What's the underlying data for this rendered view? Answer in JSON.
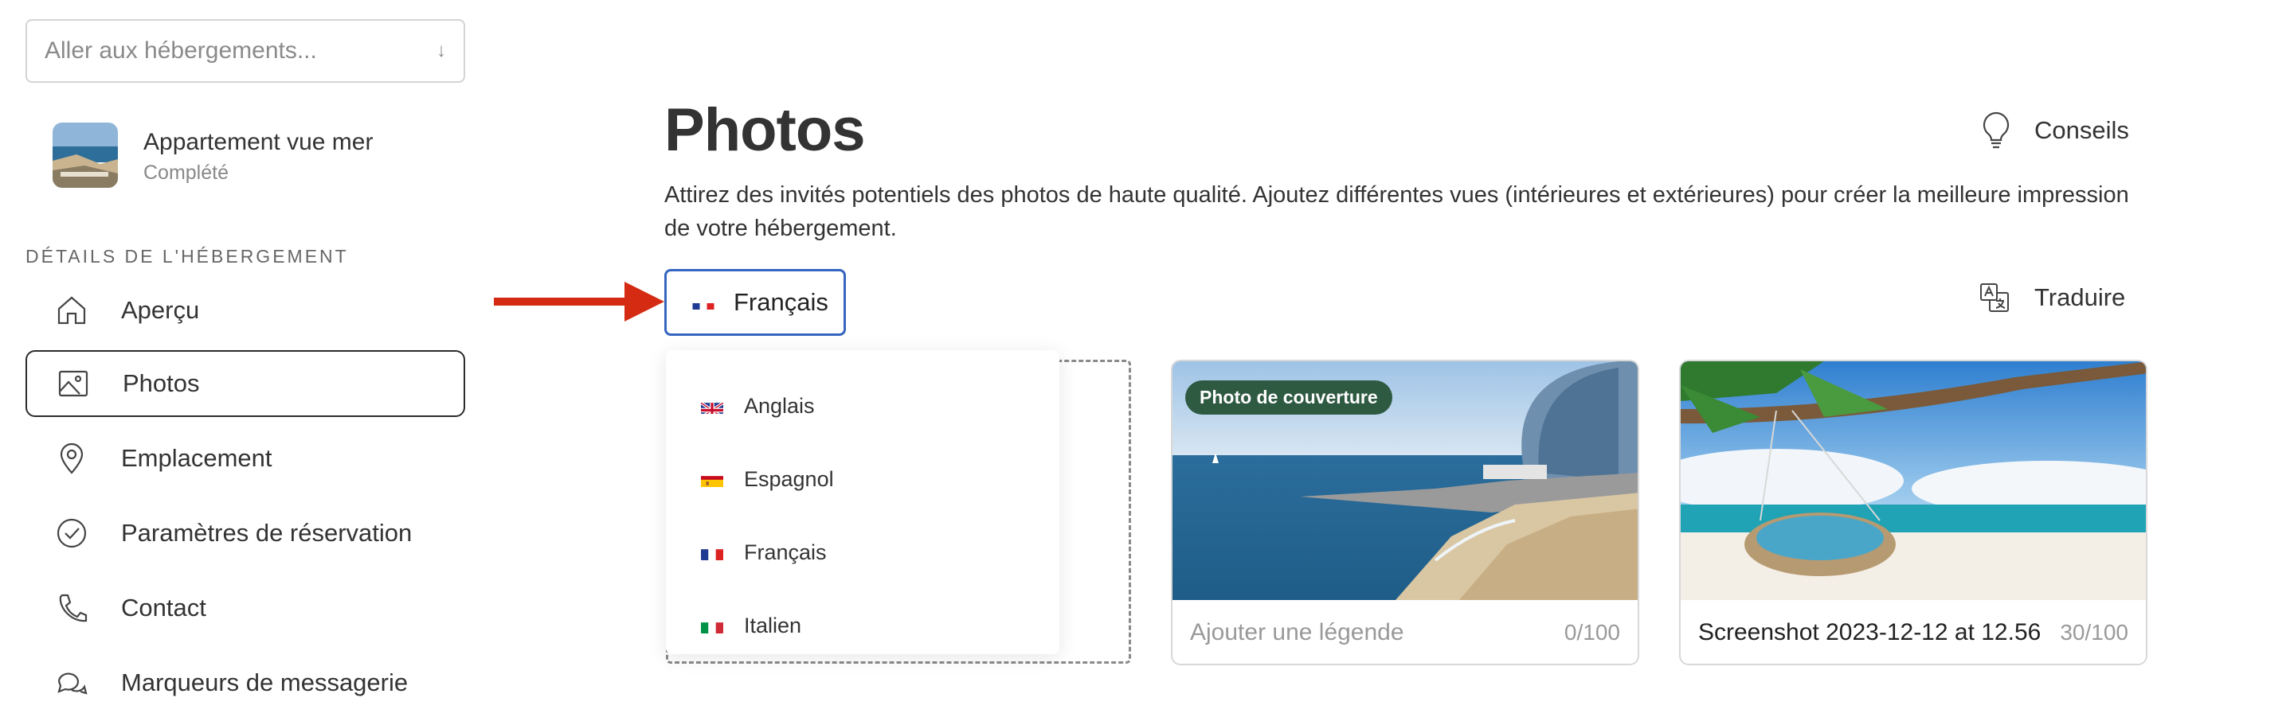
{
  "goto": {
    "placeholder": "Aller aux hébergements...",
    "chevron": "↓"
  },
  "property": {
    "name": "Appartement vue mer",
    "status": "Complété"
  },
  "sidebar": {
    "section_label": "DÉTAILS DE L'HÉBERGEMENT",
    "items": [
      {
        "label": "Aperçu",
        "icon": "home-icon"
      },
      {
        "label": "Photos",
        "icon": "image-icon",
        "active": true
      },
      {
        "label": "Emplacement",
        "icon": "location-pin-icon"
      },
      {
        "label": "Paramètres de réservation",
        "icon": "check-circle-icon"
      },
      {
        "label": "Contact",
        "icon": "phone-icon"
      },
      {
        "label": "Marqueurs de messagerie",
        "icon": "chat-bubbles-icon"
      }
    ]
  },
  "main": {
    "title": "Photos",
    "tips_label": "Conseils",
    "description": "Attirez des invités potentiels des photos de haute qualité. Ajoutez différentes vues (intérieures et extérieures) pour créer la meilleure impression de votre hébergement.",
    "language_selected": "Français",
    "translate_label": "Traduire",
    "language_options": [
      "Anglais",
      "Espagnol",
      "Français",
      "Italien"
    ]
  },
  "photos": [
    {
      "badge": "Photo de couverture",
      "caption": "Ajouter une légende",
      "caption_is_placeholder": true,
      "count": "0/100"
    },
    {
      "badge": "",
      "caption": "Screenshot 2023-12-12 at 12.56",
      "caption_is_placeholder": false,
      "count": "30/100"
    }
  ],
  "colors": {
    "accent_blue": "#3565c0",
    "badge_green": "#2f5a42",
    "arrow_red": "#d52b12"
  }
}
